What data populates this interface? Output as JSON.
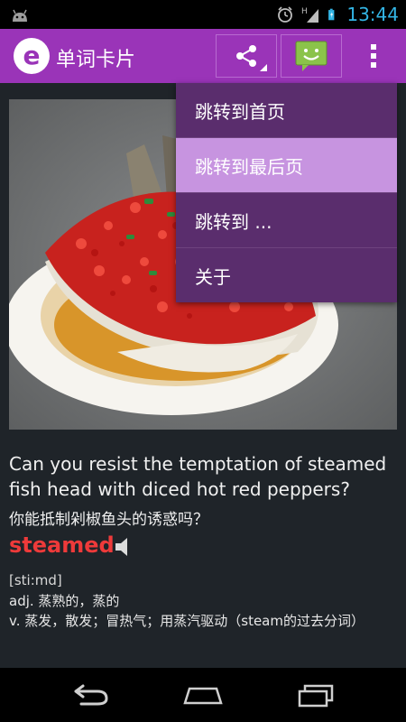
{
  "status_bar": {
    "time": "13:44",
    "network": "H"
  },
  "action_bar": {
    "title": "单词卡片",
    "logo_letter": "e"
  },
  "card": {
    "sentence_en": "Can you resist the temptation of steamed fish head with diced hot red peppers?",
    "sentence_zh": "你能抵制剁椒鱼头的诱惑吗？",
    "word": "steamed",
    "phonetic": "[sti:md]",
    "definitions": [
      "adj. 蒸熟的，蒸的",
      "v. 蒸发，散发；冒热气；用蒸汽驱动（steam的过去分词）"
    ]
  },
  "menu": {
    "items": [
      {
        "label": "跳转到首页"
      },
      {
        "label": "跳转到最后页"
      },
      {
        "label": "跳转到 ..."
      },
      {
        "label": "关于"
      }
    ]
  },
  "colors": {
    "action_bar": "#9a34b8",
    "menu_bg": "#5a2d6d",
    "menu_highlight": "#c794e0",
    "word": "#ee3a3a",
    "clock": "#33b5e5",
    "background": "#1f2429"
  },
  "icons": {
    "status_left": "android-icon",
    "alarm": "alarm-icon",
    "signal": "signal-icon",
    "battery": "battery-icon",
    "share": "share-icon",
    "sms": "sms-icon",
    "overflow": "overflow-menu-icon",
    "speaker": "speaker-icon",
    "back": "back-icon",
    "home": "home-icon",
    "recents": "recents-icon"
  }
}
